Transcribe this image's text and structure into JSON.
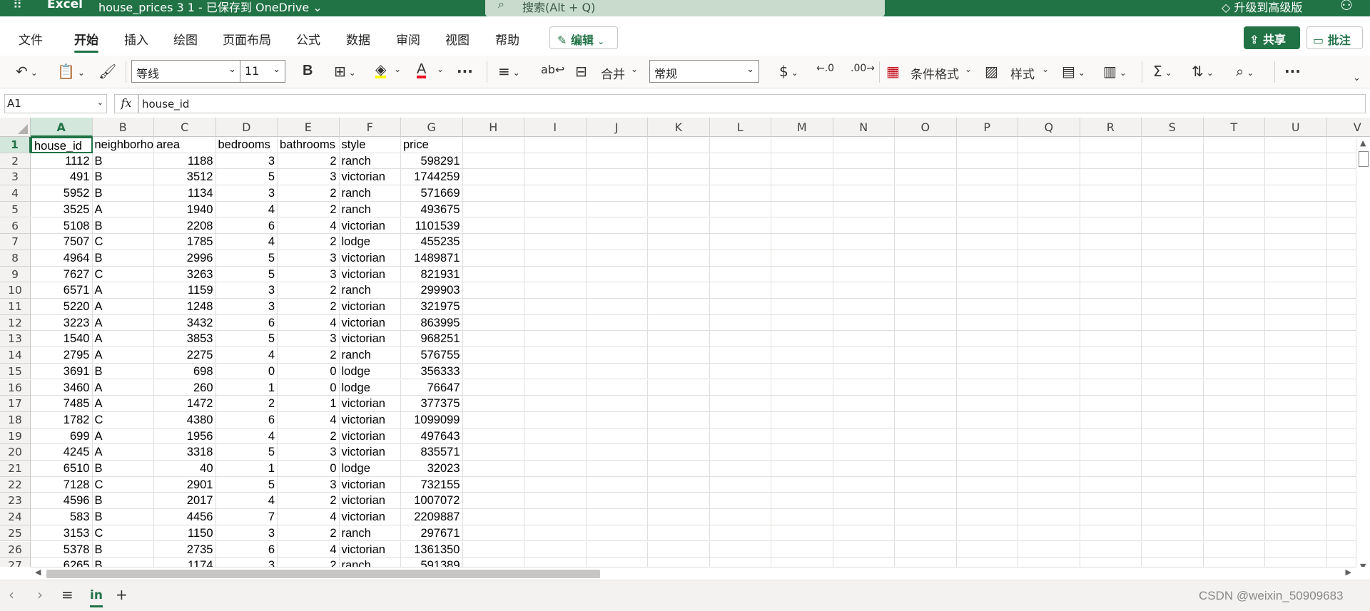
{
  "titlebar": {
    "app_name": "Excel",
    "doc_title": "house_prices 3 1 - 已保存到 OneDrive ⌄",
    "search_placeholder": "搜索(Alt + Q)",
    "upgrade": "升级到高级版"
  },
  "menu": {
    "tabs": [
      "文件",
      "开始",
      "插入",
      "绘图",
      "页面布局",
      "公式",
      "数据",
      "审阅",
      "视图",
      "帮助"
    ],
    "active_tab": "开始",
    "edit_label": "编辑",
    "share_label": "共享",
    "comment_label": "批注"
  },
  "ribbon": {
    "font_name": "等线",
    "font_size": "11",
    "merge_label": "合并",
    "number_format": "常规",
    "conditional_format": "条件格式",
    "styles": "样式",
    "more": "···"
  },
  "formula_bar": {
    "name_box": "A1",
    "fx_label": "fx",
    "content": "house_id"
  },
  "grid": {
    "columns": [
      "A",
      "B",
      "C",
      "D",
      "E",
      "F",
      "G",
      "H",
      "I",
      "J",
      "K",
      "L",
      "M",
      "N",
      "O",
      "P",
      "Q",
      "R",
      "S",
      "T",
      "U",
      "V"
    ],
    "selected_col": "A",
    "row_numbers": [
      "1",
      "2",
      "3",
      "4",
      "5",
      "6",
      "7",
      "8",
      "9",
      "10",
      "11",
      "12",
      "13",
      "14",
      "15",
      "16",
      "17",
      "18",
      "19",
      "20",
      "21",
      "22",
      "23",
      "24",
      "25",
      "26",
      "27"
    ],
    "header": [
      "house_id",
      "neighborhood",
      "area",
      "bedrooms",
      "bathrooms",
      "style",
      "price"
    ],
    "rows": [
      [
        "1112",
        "B",
        "1188",
        "3",
        "2",
        "ranch",
        "598291"
      ],
      [
        "491",
        "B",
        "3512",
        "5",
        "3",
        "victorian",
        "1744259"
      ],
      [
        "5952",
        "B",
        "1134",
        "3",
        "2",
        "ranch",
        "571669"
      ],
      [
        "3525",
        "A",
        "1940",
        "4",
        "2",
        "ranch",
        "493675"
      ],
      [
        "5108",
        "B",
        "2208",
        "6",
        "4",
        "victorian",
        "1101539"
      ],
      [
        "7507",
        "C",
        "1785",
        "4",
        "2",
        "lodge",
        "455235"
      ],
      [
        "4964",
        "B",
        "2996",
        "5",
        "3",
        "victorian",
        "1489871"
      ],
      [
        "7627",
        "C",
        "3263",
        "5",
        "3",
        "victorian",
        "821931"
      ],
      [
        "6571",
        "A",
        "1159",
        "3",
        "2",
        "ranch",
        "299903"
      ],
      [
        "5220",
        "A",
        "1248",
        "3",
        "2",
        "victorian",
        "321975"
      ],
      [
        "3223",
        "A",
        "3432",
        "6",
        "4",
        "victorian",
        "863995"
      ],
      [
        "1540",
        "A",
        "3853",
        "5",
        "3",
        "victorian",
        "968251"
      ],
      [
        "2795",
        "A",
        "2275",
        "4",
        "2",
        "ranch",
        "576755"
      ],
      [
        "3691",
        "B",
        "698",
        "0",
        "0",
        "lodge",
        "356333"
      ],
      [
        "3460",
        "A",
        "260",
        "1",
        "0",
        "lodge",
        "76647"
      ],
      [
        "7485",
        "A",
        "1472",
        "2",
        "1",
        "victorian",
        "377375"
      ],
      [
        "1782",
        "C",
        "4380",
        "6",
        "4",
        "victorian",
        "1099099"
      ],
      [
        "699",
        "A",
        "1956",
        "4",
        "2",
        "victorian",
        "497643"
      ],
      [
        "4245",
        "A",
        "3318",
        "5",
        "3",
        "victorian",
        "835571"
      ],
      [
        "6510",
        "B",
        "40",
        "1",
        "0",
        "lodge",
        "32023"
      ],
      [
        "7128",
        "C",
        "2901",
        "5",
        "3",
        "victorian",
        "732155"
      ],
      [
        "4596",
        "B",
        "2017",
        "4",
        "2",
        "victorian",
        "1007072"
      ],
      [
        "583",
        "B",
        "4456",
        "7",
        "4",
        "victorian",
        "2209887"
      ],
      [
        "3153",
        "C",
        "1150",
        "3",
        "2",
        "ranch",
        "297671"
      ],
      [
        "5378",
        "B",
        "2735",
        "6",
        "4",
        "victorian",
        "1361350"
      ],
      [
        "6265",
        "B",
        "1174",
        "3",
        "2",
        "ranch",
        "591389"
      ]
    ]
  },
  "sheets": {
    "tabs": [
      "in"
    ],
    "active": "in"
  },
  "watermark": "CSDN @weixin_50909683",
  "colors": {
    "brand": "#217346",
    "search_bg": "#c8dbcd",
    "selection_header": "#d3e7dc"
  }
}
